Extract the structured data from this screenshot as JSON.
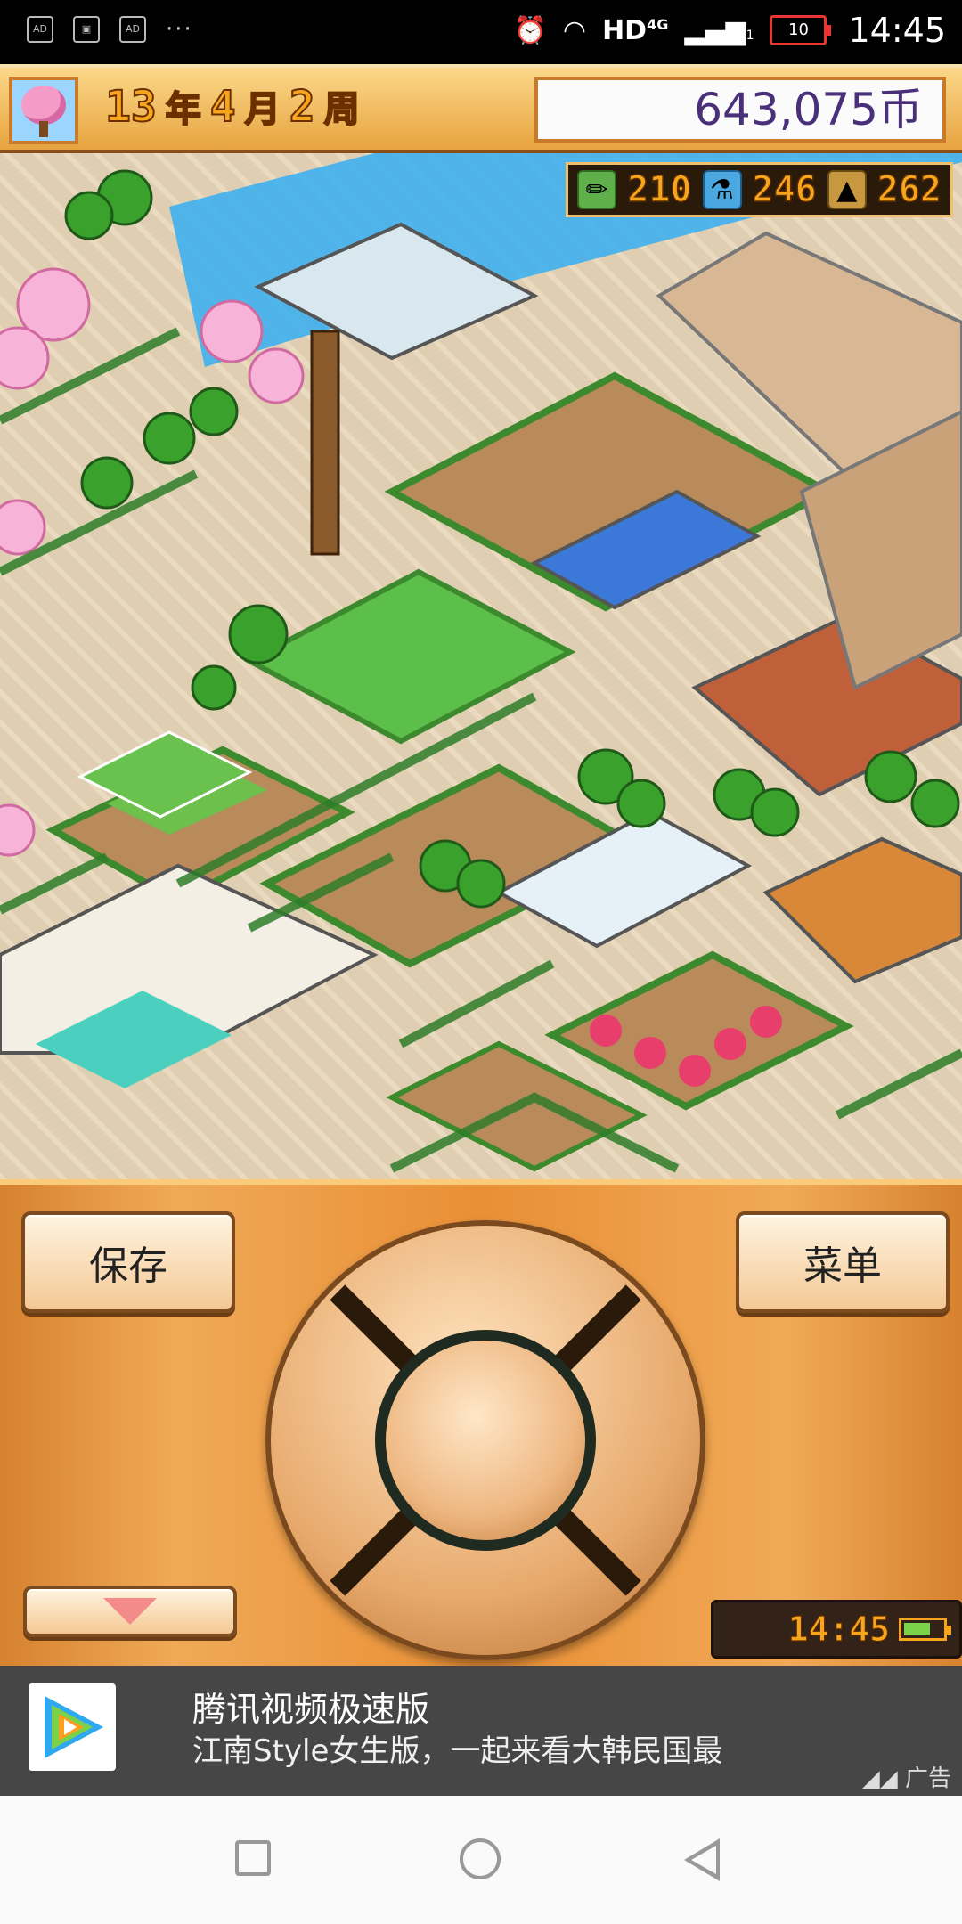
{
  "status_bar": {
    "ad_icons": [
      "AD",
      "AD"
    ],
    "more": "···",
    "network": "HD",
    "network_type": "4G",
    "sim": "1",
    "battery": "10",
    "time": "14:45"
  },
  "top_bar": {
    "year": "13",
    "year_unit": "年",
    "month": "4",
    "month_unit": "月",
    "week": "2",
    "week_unit": "周",
    "money": "643,075币"
  },
  "resources": {
    "pencil_icon": "pencil-icon",
    "pencil_value": "210",
    "research_icon": "flask-icon",
    "research_value": "246",
    "tower_icon": "tower-icon",
    "tower_value": "262"
  },
  "controls": {
    "save_label": "保存",
    "menu_label": "菜单",
    "clock": "14:45"
  },
  "ad": {
    "title": "腾讯视频极速版",
    "subtitle": "江南Style女生版，一起来看大韩民国最",
    "label": "广告"
  },
  "colors": {
    "panel_orange": "#e98f35",
    "digits": "#f7a51c",
    "money_text": "#4a2f7a"
  }
}
